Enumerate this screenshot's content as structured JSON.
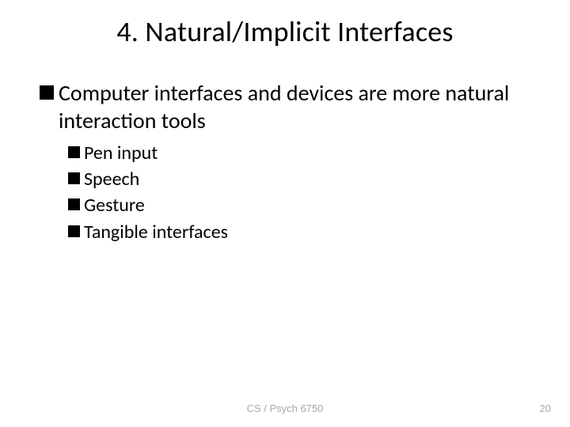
{
  "title": "4. Natural/Implicit Interfaces",
  "main_bullet": "Computer interfaces and devices are more natural interaction tools",
  "sub_bullets": {
    "0": "Pen input",
    "1": "Speech",
    "2": "Gesture",
    "3": "Tangible interfaces"
  },
  "footer": {
    "course": "CS / Psych 6750",
    "page": "20"
  }
}
